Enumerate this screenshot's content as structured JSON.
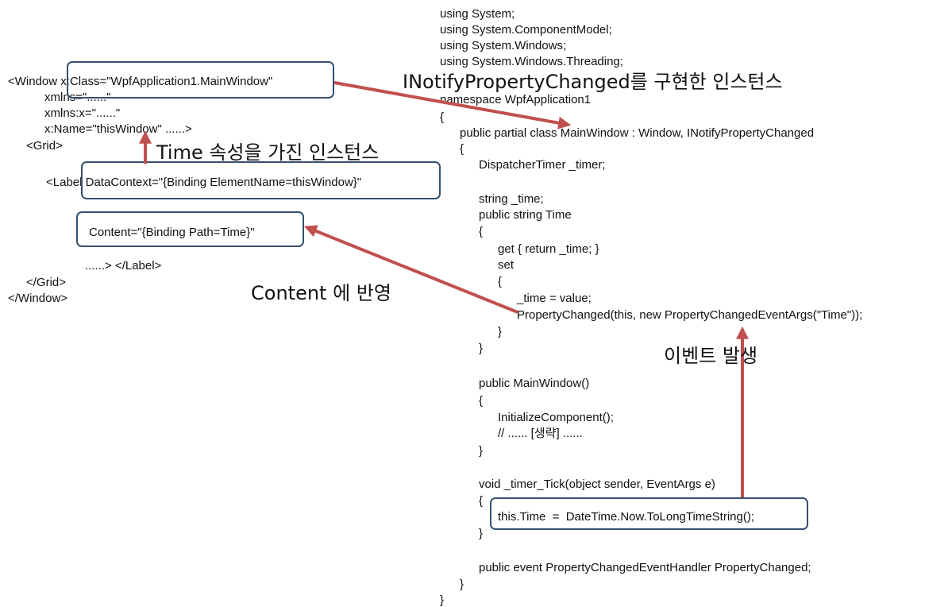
{
  "xaml": {
    "lines": [
      "<Window x:Class=\"WpfApplication1.MainWindow\"",
      "xmlns=\"......\"",
      "xmlns:x=\"......\"",
      "x:Name=\"thisWindow\" ......>",
      "<Grid>",
      "<Label DataContext=\"{Binding ElementName=thisWindow}\"",
      "Content=\"{Binding Path=Time}\"",
      "......> </Label>",
      "</Grid>",
      "</Window>"
    ]
  },
  "csharp": {
    "lines": [
      "using System;",
      "using System.ComponentModel;",
      "using System.Windows;",
      "using System.Windows.Threading;",
      "namespace WpfApplication1",
      "{",
      "public partial class MainWindow : Window, INotifyPropertyChanged",
      "{",
      "DispatcherTimer _timer;",
      "string _time;",
      "public string Time",
      "{",
      "get { return _time; }",
      "set",
      "{",
      "_time = value;",
      "PropertyChanged(this, new PropertyChangedEventArgs(\"Time\"));",
      "}",
      "}",
      "public MainWindow()",
      "{",
      "InitializeComponent();",
      "// ...... [생략] ......",
      "}",
      "void _timer_Tick(object sender, EventArgs e)",
      "{",
      "this.Time  =  DateTime.Now.ToLongTimeString();",
      "}",
      "public event PropertyChangedEventHandler PropertyChanged;",
      "}",
      "}"
    ]
  },
  "annotations": {
    "inotify": "INotifyPropertyChanged를 구현한 인스턴스",
    "time_instance": "Time 속성을 가진 인스턴스",
    "content_reflect": "Content 에 반영",
    "event_fire": "이벤트 발생"
  },
  "colors": {
    "arrow": "#c0504d",
    "box_border": "#34516f",
    "text": "#111111"
  }
}
